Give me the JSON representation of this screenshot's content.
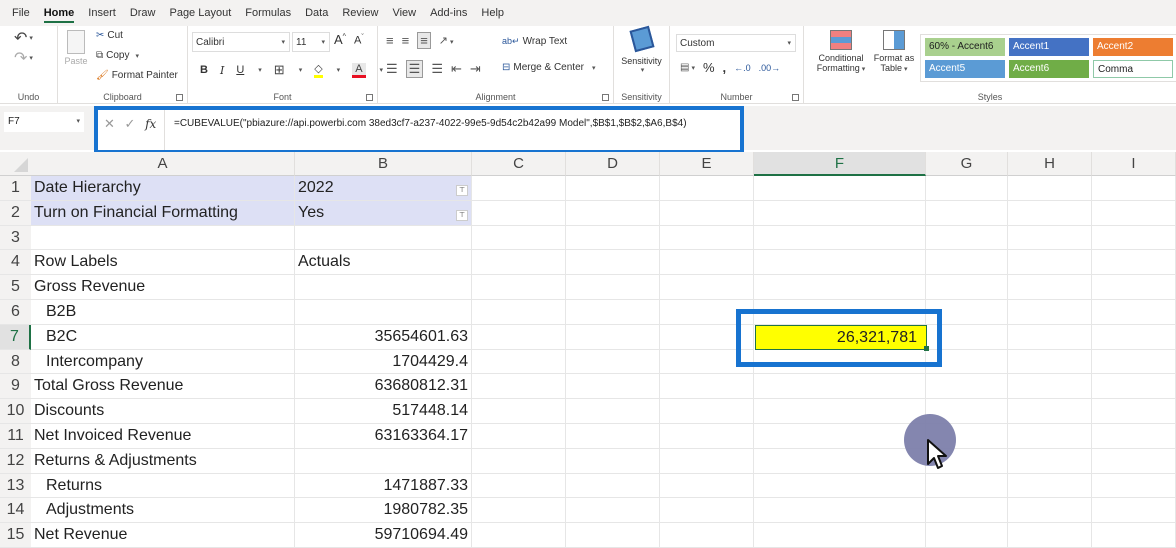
{
  "menu": {
    "tabs": [
      "File",
      "Home",
      "Insert",
      "Draw",
      "Page Layout",
      "Formulas",
      "Data",
      "Review",
      "View",
      "Add-ins",
      "Help"
    ],
    "active_tab": "Home"
  },
  "ribbon": {
    "undo": {
      "label": "Undo"
    },
    "clipboard": {
      "label": "Clipboard",
      "paste": "Paste",
      "cut": "Cut",
      "copy": "Copy",
      "format_painter": "Format Painter"
    },
    "font": {
      "label": "Font",
      "family": "Calibri",
      "size": "11",
      "bold": "B",
      "italic": "I",
      "underline": "U",
      "font_color": "#e81123",
      "fill_color": "#ffff00"
    },
    "alignment": {
      "label": "Alignment",
      "wrap_text": "Wrap Text",
      "merge_center": "Merge & Center"
    },
    "sensitivity": {
      "label": "Sensitivity",
      "button": "Sensitivity"
    },
    "number": {
      "label": "Number",
      "format": "Custom",
      "percent": "%",
      "comma": "9"
    },
    "styles": {
      "label": "Styles",
      "conditional_formatting": [
        "Conditional",
        "Formatting"
      ],
      "format_as_table": [
        "Format as",
        "Table"
      ],
      "gallery": [
        {
          "name": "60% - Accent6",
          "bg": "#a9d08e",
          "fg": "#1e1e1e"
        },
        {
          "name": "Accent1",
          "bg": "#4472c4",
          "fg": "#ffffff"
        },
        {
          "name": "Accent2",
          "bg": "#ed7d31",
          "fg": "#ffffff"
        },
        {
          "name": "Accent5",
          "bg": "#5b9bd5",
          "fg": "#ffffff"
        },
        {
          "name": "Accent6",
          "bg": "#70ad47",
          "fg": "#ffffff"
        },
        {
          "name": "Comma",
          "bg": "#ffffff",
          "fg": "#1e1e1e"
        }
      ]
    }
  },
  "formula_bar": {
    "name_box": "F7",
    "formula": "=CUBEVALUE(\"pbiazure://api.powerbi.com 38ed3cf7-a237-4022-99e5-9d54c2b42a99 Model\",$B$1,$B$2,$A6,B$4)",
    "highlight_color": "#1773d0"
  },
  "grid": {
    "columns": [
      "A",
      "B",
      "C",
      "D",
      "E",
      "F",
      "G",
      "H",
      "I"
    ],
    "selected_column": "F",
    "selected_row": "7",
    "rows": [
      {
        "n": "1",
        "a": "Date Hierarchy",
        "b": "2022",
        "slicer": true
      },
      {
        "n": "2",
        "a": "Turn on Financial Formatting",
        "b": "Yes",
        "slicer": true
      },
      {
        "n": "3",
        "a": "",
        "b": ""
      },
      {
        "n": "4",
        "a": "Row Labels",
        "b": "Actuals",
        "b_left": true
      },
      {
        "n": "5",
        "a": "Gross Revenue",
        "b": ""
      },
      {
        "n": "6",
        "a": "B2B",
        "b": "",
        "indent": true
      },
      {
        "n": "7",
        "a": "B2C",
        "b": "35654601.63",
        "indent": true
      },
      {
        "n": "8",
        "a": "Intercompany",
        "b": "1704429.4",
        "indent": true
      },
      {
        "n": "9",
        "a": "Total Gross Revenue",
        "b": "63680812.31"
      },
      {
        "n": "10",
        "a": "Discounts",
        "b": "517448.14"
      },
      {
        "n": "11",
        "a": "Net Invoiced Revenue",
        "b": "63163364.17"
      },
      {
        "n": "12",
        "a": "Returns & Adjustments",
        "b": ""
      },
      {
        "n": "13",
        "a": "Returns",
        "b": "1471887.33",
        "indent": true
      },
      {
        "n": "14",
        "a": "Adjustments",
        "b": "1980782.35",
        "indent": true
      },
      {
        "n": "15",
        "a": "Net Revenue",
        "b": "59710694.49"
      }
    ],
    "active_cell": {
      "ref": "F7",
      "value": "26,321,781",
      "fill": "#ffff00"
    }
  }
}
